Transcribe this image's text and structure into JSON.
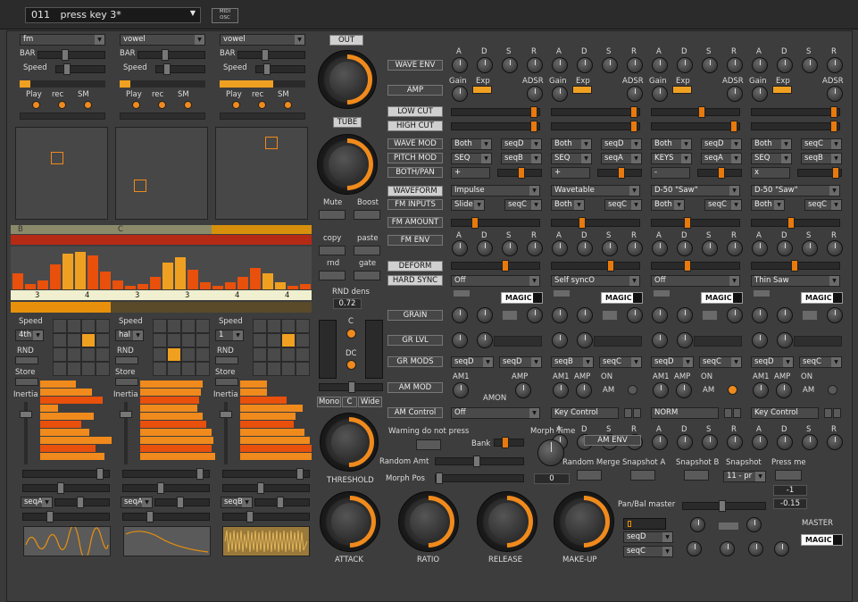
{
  "header": {
    "preset_number": "011",
    "preset_name": "press key 3*",
    "midi_label": "MIDI",
    "osc_label": "OSC"
  },
  "left": {
    "col1": {
      "mode": "fm",
      "speed_label": "Speed",
      "bar_label": "BAR",
      "play": "Play",
      "rec": "rec",
      "sm": "SM",
      "rnd": "RND",
      "store": "Store",
      "inertia": "Inertia",
      "speed_value": "4th",
      "seq": "seqA"
    },
    "col2": {
      "mode": "vowel",
      "speed_label": "Speed",
      "bar_label": "BAR",
      "play": "Play",
      "rec": "rec",
      "sm": "SM",
      "rnd": "RND",
      "store": "Store",
      "inertia": "Inertia",
      "speed_value": "hal",
      "seq": "seqA"
    },
    "col3": {
      "mode": "vowel",
      "speed_label": "Speed",
      "bar_label": "BAR",
      "play": "Play",
      "rec": "rec",
      "sm": "SM",
      "rnd": "RND",
      "store": "Store",
      "inertia": "Inertia",
      "speed_value": "1",
      "seq": "seqB"
    },
    "seq_letters": [
      "B",
      "C"
    ],
    "seq_numbers": [
      "3",
      "4",
      "3",
      "3",
      "4",
      "4"
    ]
  },
  "center": {
    "out": "OUT",
    "tube": "TUBE",
    "mute": "Mute",
    "boost": "Boost",
    "copy": "copy",
    "paste": "paste",
    "rnd": "rnd",
    "gate": "gate",
    "rnd_dens_label": "RND dens",
    "rnd_dens_value": "0.72",
    "c_label": "C",
    "dc_label": "DC",
    "mono": "Mono",
    "c": "C",
    "wide": "Wide",
    "threshold": "THRESHOLD",
    "attack": "ATTACK",
    "ratio": "RATIO",
    "release": "RELEASE",
    "makeup": "MAKE-UP"
  },
  "rowlabels": [
    "WAVE ENV",
    "AMP",
    "LOW CUT",
    "HIGH CUT",
    "WAVE MOD",
    "PITCH MOD",
    "BOTH/PAN",
    "WAVEFORM",
    "FM INPUTS",
    "FM AMOUNT",
    "FM ENV",
    "DEFORM",
    "HARD SYNC",
    "GRAIN",
    "GR LVL",
    "GR MODS",
    "AM MOD",
    "AM Control"
  ],
  "adsr": [
    "A",
    "D",
    "S",
    "R"
  ],
  "gain": "Gain",
  "exp": "Exp",
  "adsr_label": "ADSR",
  "osc": [
    {
      "wm1": "Both",
      "wm2": "seqD",
      "pm1": "SEQ",
      "pm2": "seqB",
      "bp": "+",
      "wave": "Impulse",
      "fm1": "Slide",
      "fm2": "seqC",
      "hs": "Off",
      "grm1": "seqD",
      "grm2": "seqD",
      "amc": "Off"
    },
    {
      "wm1": "Both",
      "wm2": "seqD",
      "pm1": "SEQ",
      "pm2": "seqA",
      "bp": "+",
      "wave": "Wavetable",
      "fm1": "Both",
      "fm2": "seqC",
      "hs": "Self syncO",
      "grm1": "seqB",
      "grm2": "seqC",
      "amc": "Key Control"
    },
    {
      "wm1": "Both",
      "wm2": "seqD",
      "pm1": "KEYS",
      "pm2": "seqA",
      "bp": "-",
      "wave": "D-50 \"Saw\"",
      "fm1": "Both",
      "fm2": "seqC",
      "hs": "Off",
      "grm1": "seqD",
      "grm2": "seqC",
      "amc": "NORM"
    },
    {
      "wm1": "Both",
      "wm2": "seqC",
      "pm1": "SEQ",
      "pm2": "seqB",
      "bp": "x",
      "wave": "D-50 \"Saw\"",
      "fm1": "Both",
      "fm2": "seqC",
      "hs": "Thin Saw",
      "grm1": "seqD",
      "grm2": "seqC",
      "amc": "Key Control"
    }
  ],
  "magic": "MAGIC",
  "am": {
    "am1": "AM1",
    "amp": "AMP",
    "amon": "AMON",
    "on": "ON",
    "am": "AM"
  },
  "morph": {
    "warning": "Warning do not press",
    "bank": "Bank",
    "morph_time": "Morph Time",
    "random_amt": "Random Amt",
    "morph_pos": "Morph Pos",
    "morph_value": "0",
    "am_env": "AM ENV",
    "random_merge": "Random Merge",
    "snapshot_a": "Snapshot A",
    "snapshot_b": "Snapshot B",
    "snapshot": "Snapshot",
    "snap_value": "11 - pr",
    "press_me": "Press me",
    "press_value": "-1",
    "pan_label": "Pan/Bal master",
    "pan_value": "-0.15",
    "seq1": "seqD",
    "seq2": "seqC",
    "master": "MASTER"
  }
}
